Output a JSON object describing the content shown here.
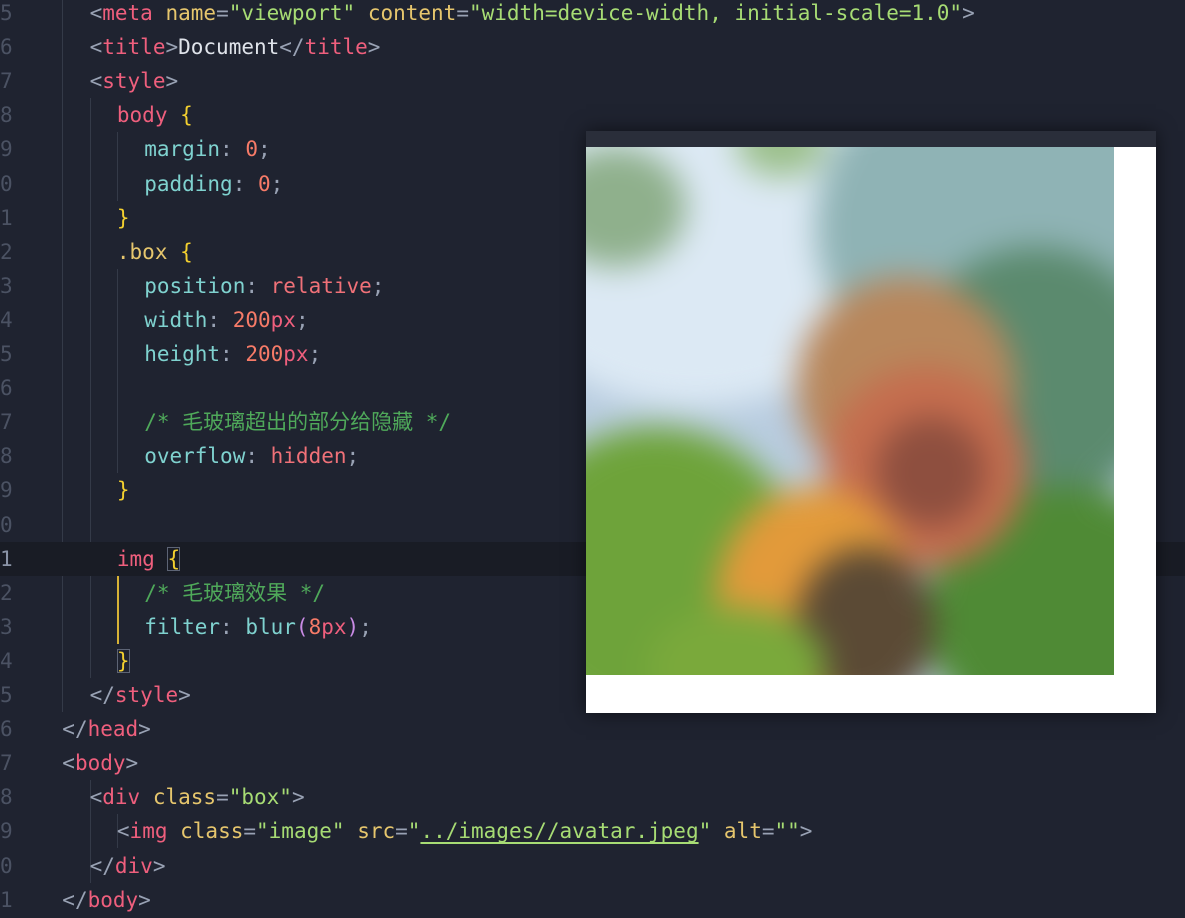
{
  "editor": {
    "line_numbers": [
      "5",
      "6",
      "7",
      "8",
      "9",
      "0",
      "1",
      "2",
      "3",
      "4",
      "5",
      "6",
      "7",
      "8",
      "9",
      "0",
      "1",
      "2",
      "3",
      "4",
      "5",
      "6",
      "7",
      "8",
      "9",
      "0",
      "1"
    ],
    "lines": [
      [
        {
          "c": "t-punc",
          "t": "<"
        },
        {
          "c": "t-tag",
          "t": "meta"
        },
        {
          "c": "t-text",
          "t": " "
        },
        {
          "c": "t-attr",
          "t": "name"
        },
        {
          "c": "t-punc",
          "t": "="
        },
        {
          "c": "t-str",
          "t": "\"viewport\""
        },
        {
          "c": "t-text",
          "t": " "
        },
        {
          "c": "t-attr",
          "t": "content"
        },
        {
          "c": "t-punc",
          "t": "="
        },
        {
          "c": "t-str",
          "t": "\"width=device-width, initial-scale=1.0\""
        },
        {
          "c": "t-punc",
          "t": ">"
        }
      ],
      [
        {
          "c": "t-punc",
          "t": "<"
        },
        {
          "c": "t-tag",
          "t": "title"
        },
        {
          "c": "t-punc",
          "t": ">"
        },
        {
          "c": "t-text",
          "t": "Document"
        },
        {
          "c": "t-punc",
          "t": "</"
        },
        {
          "c": "t-tag",
          "t": "title"
        },
        {
          "c": "t-punc",
          "t": ">"
        }
      ],
      [
        {
          "c": "t-punc",
          "t": "<"
        },
        {
          "c": "t-tag",
          "t": "style"
        },
        {
          "c": "t-punc",
          "t": ">"
        }
      ],
      [
        {
          "c": "t-sel",
          "t": "body"
        },
        {
          "c": "t-text",
          "t": " "
        },
        {
          "c": "t-brace",
          "t": "{"
        }
      ],
      [
        {
          "c": "t-prop",
          "t": "margin"
        },
        {
          "c": "t-punc",
          "t": ": "
        },
        {
          "c": "t-num",
          "t": "0"
        },
        {
          "c": "t-punc",
          "t": ";"
        }
      ],
      [
        {
          "c": "t-prop",
          "t": "padding"
        },
        {
          "c": "t-punc",
          "t": ": "
        },
        {
          "c": "t-num",
          "t": "0"
        },
        {
          "c": "t-punc",
          "t": ";"
        }
      ],
      [
        {
          "c": "t-brace",
          "t": "}"
        }
      ],
      [
        {
          "c": "t-attr",
          "t": ".box"
        },
        {
          "c": "t-text",
          "t": " "
        },
        {
          "c": "t-brace",
          "t": "{"
        }
      ],
      [
        {
          "c": "t-prop",
          "t": "position"
        },
        {
          "c": "t-punc",
          "t": ": "
        },
        {
          "c": "t-kw",
          "t": "relative"
        },
        {
          "c": "t-punc",
          "t": ";"
        }
      ],
      [
        {
          "c": "t-prop",
          "t": "width"
        },
        {
          "c": "t-punc",
          "t": ": "
        },
        {
          "c": "t-num",
          "t": "200"
        },
        {
          "c": "t-unit",
          "t": "px"
        },
        {
          "c": "t-punc",
          "t": ";"
        }
      ],
      [
        {
          "c": "t-prop",
          "t": "height"
        },
        {
          "c": "t-punc",
          "t": ": "
        },
        {
          "c": "t-num",
          "t": "200"
        },
        {
          "c": "t-unit",
          "t": "px"
        },
        {
          "c": "t-punc",
          "t": ";"
        }
      ],
      [],
      [
        {
          "c": "t-cmt",
          "t": "/* 毛玻璃超出的部分给隐藏 */"
        }
      ],
      [
        {
          "c": "t-prop",
          "t": "overflow"
        },
        {
          "c": "t-punc",
          "t": ": "
        },
        {
          "c": "t-kw",
          "t": "hidden"
        },
        {
          "c": "t-punc",
          "t": ";"
        }
      ],
      [
        {
          "c": "t-brace",
          "t": "}"
        }
      ],
      [],
      [
        {
          "c": "t-sel",
          "t": "img"
        },
        {
          "c": "t-text",
          "t": " "
        },
        {
          "c": "t-brace brace-box",
          "t": "{"
        }
      ],
      [
        {
          "c": "t-cmt",
          "t": "/* 毛玻璃效果 */"
        }
      ],
      [
        {
          "c": "t-prop",
          "t": "filter"
        },
        {
          "c": "t-punc",
          "t": ": "
        },
        {
          "c": "t-fn",
          "t": "blur"
        },
        {
          "c": "t-paren",
          "t": "("
        },
        {
          "c": "t-num",
          "t": "8"
        },
        {
          "c": "t-unit",
          "t": "px"
        },
        {
          "c": "t-paren",
          "t": ")"
        },
        {
          "c": "t-punc",
          "t": ";"
        }
      ],
      [
        {
          "c": "t-brace brace-box",
          "t": "}"
        }
      ],
      [
        {
          "c": "t-punc",
          "t": "</"
        },
        {
          "c": "t-tag",
          "t": "style"
        },
        {
          "c": "t-punc",
          "t": ">"
        }
      ],
      [
        {
          "c": "t-punc",
          "t": "</"
        },
        {
          "c": "t-tag",
          "t": "head"
        },
        {
          "c": "t-punc",
          "t": ">"
        }
      ],
      [
        {
          "c": "t-punc",
          "t": "<"
        },
        {
          "c": "t-tag",
          "t": "body"
        },
        {
          "c": "t-punc",
          "t": ">"
        }
      ],
      [
        {
          "c": "t-punc",
          "t": "<"
        },
        {
          "c": "t-tag",
          "t": "div"
        },
        {
          "c": "t-text",
          "t": " "
        },
        {
          "c": "t-attr",
          "t": "class"
        },
        {
          "c": "t-punc",
          "t": "="
        },
        {
          "c": "t-str",
          "t": "\"box\""
        },
        {
          "c": "t-punc",
          "t": ">"
        }
      ],
      [
        {
          "c": "t-punc",
          "t": "<"
        },
        {
          "c": "t-tag",
          "t": "img"
        },
        {
          "c": "t-text",
          "t": " "
        },
        {
          "c": "t-attr",
          "t": "class"
        },
        {
          "c": "t-punc",
          "t": "="
        },
        {
          "c": "t-str",
          "t": "\"image\""
        },
        {
          "c": "t-text",
          "t": " "
        },
        {
          "c": "t-attr",
          "t": "src"
        },
        {
          "c": "t-punc",
          "t": "="
        },
        {
          "c": "t-str",
          "t": "\""
        },
        {
          "c": "t-link",
          "t": "../images//avatar.jpeg"
        },
        {
          "c": "t-str",
          "t": "\""
        },
        {
          "c": "t-text",
          "t": " "
        },
        {
          "c": "t-attr",
          "t": "alt"
        },
        {
          "c": "t-punc",
          "t": "="
        },
        {
          "c": "t-str",
          "t": "\"\""
        },
        {
          "c": "t-punc",
          "t": ">"
        }
      ],
      [
        {
          "c": "t-punc",
          "t": "</"
        },
        {
          "c": "t-tag",
          "t": "div"
        },
        {
          "c": "t-punc",
          "t": ">"
        }
      ],
      [
        {
          "c": "t-punc",
          "t": "</"
        },
        {
          "c": "t-tag",
          "t": "body"
        },
        {
          "c": "t-punc",
          "t": ">"
        }
      ]
    ]
  },
  "preview": {
    "image_description": "blurred-avatar-image"
  },
  "colors": {
    "editor_background": "#1f2330",
    "current_line": "#191c25",
    "active_guide": "#d7b236"
  }
}
